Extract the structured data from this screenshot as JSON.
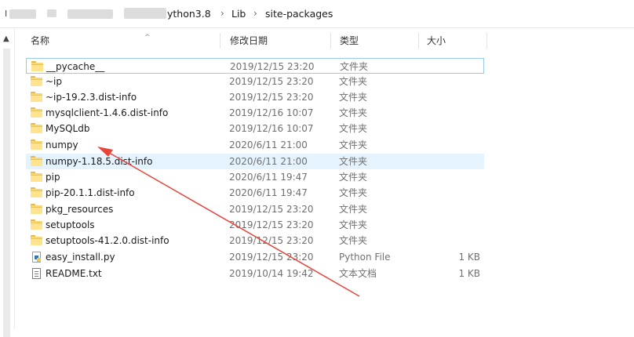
{
  "address": {
    "start": "I",
    "crumbs": [
      "ython3.8",
      "Lib",
      "site-packages"
    ],
    "separator": "›"
  },
  "columns": {
    "name": "名称",
    "date": "修改日期",
    "type": "类型",
    "size": "大小"
  },
  "files": [
    {
      "name": "__pycache__",
      "date": "2019/12/15 23:20",
      "type": "文件夹",
      "size": "",
      "icon": "folder"
    },
    {
      "name": "~ip",
      "date": "2019/12/15 23:20",
      "type": "文件夹",
      "size": "",
      "icon": "folder"
    },
    {
      "name": "~ip-19.2.3.dist-info",
      "date": "2019/12/15 23:20",
      "type": "文件夹",
      "size": "",
      "icon": "folder"
    },
    {
      "name": "mysqlclient-1.4.6.dist-info",
      "date": "2019/12/16 10:07",
      "type": "文件夹",
      "size": "",
      "icon": "folder"
    },
    {
      "name": "MySQLdb",
      "date": "2019/12/16 10:07",
      "type": "文件夹",
      "size": "",
      "icon": "folder"
    },
    {
      "name": "numpy",
      "date": "2020/6/11 21:00",
      "type": "文件夹",
      "size": "",
      "icon": "folder"
    },
    {
      "name": "numpy-1.18.5.dist-info",
      "date": "2020/6/11 21:00",
      "type": "文件夹",
      "size": "",
      "icon": "folder"
    },
    {
      "name": "pip",
      "date": "2020/6/11 19:47",
      "type": "文件夹",
      "size": "",
      "icon": "folder"
    },
    {
      "name": "pip-20.1.1.dist-info",
      "date": "2020/6/11 19:47",
      "type": "文件夹",
      "size": "",
      "icon": "folder"
    },
    {
      "name": "pkg_resources",
      "date": "2019/12/15 23:20",
      "type": "文件夹",
      "size": "",
      "icon": "folder"
    },
    {
      "name": "setuptools",
      "date": "2019/12/15 23:20",
      "type": "文件夹",
      "size": "",
      "icon": "folder"
    },
    {
      "name": "setuptools-41.2.0.dist-info",
      "date": "2019/12/15 23:20",
      "type": "文件夹",
      "size": "",
      "icon": "folder"
    },
    {
      "name": "easy_install.py",
      "date": "2019/12/15 23:20",
      "type": "Python File",
      "size": "1 KB",
      "icon": "python-file"
    },
    {
      "name": "README.txt",
      "date": "2019/10/14 19:42",
      "type": "文本文档",
      "size": "1 KB",
      "icon": "text-file"
    }
  ],
  "annotation": {
    "color": "#e8443a"
  }
}
